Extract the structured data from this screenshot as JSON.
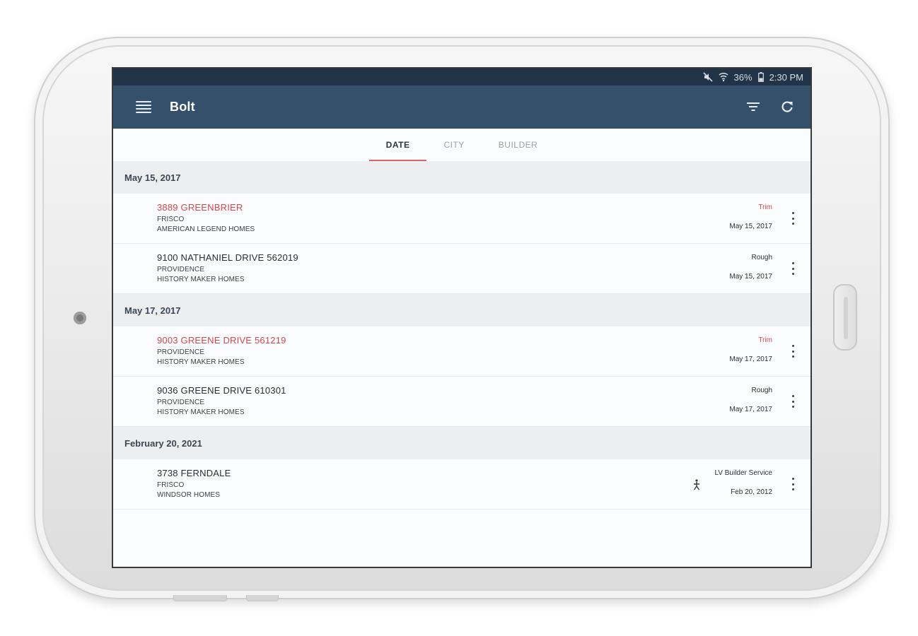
{
  "status_bar": {
    "battery": "36%",
    "time": "2:30 PM"
  },
  "app_bar": {
    "title": "Bolt"
  },
  "tabs": [
    {
      "label": "DATE",
      "active": true
    },
    {
      "label": "CITY",
      "active": false
    },
    {
      "label": "BUILDER",
      "active": false
    }
  ],
  "sections": [
    {
      "date": "May 15, 2017",
      "items": [
        {
          "address": "3889 GREENBRIER",
          "city": "FRISCO",
          "builder": "AMERICAN LEGEND HOMES",
          "stage": "Trim",
          "date": "May 15, 2017",
          "highlight": true
        },
        {
          "address": "9100 NATHANIEL DRIVE 562019",
          "city": "PROVIDENCE",
          "builder": "HISTORY MAKER HOMES",
          "stage": "Rough",
          "date": "May 15, 2017",
          "highlight": false
        }
      ]
    },
    {
      "date": "May 17, 2017",
      "items": [
        {
          "address": "9003 GREENE DRIVE 561219",
          "city": "PROVIDENCE",
          "builder": "HISTORY MAKER HOMES",
          "stage": "Trim",
          "date": "May 17, 2017",
          "highlight": true
        },
        {
          "address": "9036 GREENE DRIVE 610301",
          "city": "PROVIDENCE",
          "builder": "HISTORY MAKER HOMES",
          "stage": "Rough",
          "date": "May 17, 2017",
          "highlight": false
        }
      ]
    },
    {
      "date": "February 20, 2021",
      "items": [
        {
          "address": "3738 FERNDALE",
          "city": "FRISCO",
          "builder": "WINDSOR HOMES",
          "stage": "LV Builder Service",
          "date": "Feb 20, 2012",
          "highlight": false
        }
      ]
    }
  ],
  "colors": {
    "app_bar": "#35506a",
    "status_bar": "#213447",
    "accent_red": "#d4474a",
    "tab_indicator": "#d86464",
    "section_bg": "#eceeef"
  },
  "icons": {
    "menu": "hamburger-menu-icon",
    "filter": "filter-icon",
    "refresh": "refresh-icon",
    "more": "more-vert-icon",
    "assigned": "person-walk-icon",
    "mute": "mute-icon",
    "wifi": "wifi-icon",
    "battery": "battery-icon"
  }
}
